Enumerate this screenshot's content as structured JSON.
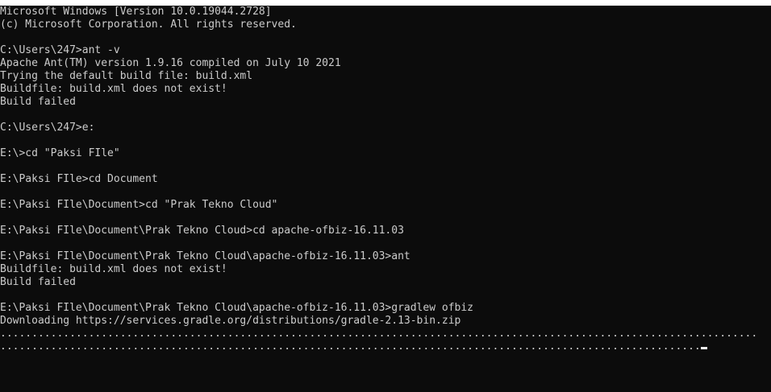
{
  "console": {
    "lines": [
      "Microsoft Windows [Version 10.0.19044.2728]",
      "(c) Microsoft Corporation. All rights reserved.",
      "",
      "C:\\Users\\247>ant -v",
      "Apache Ant(TM) version 1.9.16 compiled on July 10 2021",
      "Trying the default build file: build.xml",
      "Buildfile: build.xml does not exist!",
      "Build failed",
      "",
      "C:\\Users\\247>e:",
      "",
      "E:\\>cd \"Paksi FIle\"",
      "",
      "E:\\Paksi FIle>cd Document",
      "",
      "E:\\Paksi FIle\\Document>cd \"Prak Tekno Cloud\"",
      "",
      "E:\\Paksi FIle\\Document\\Prak Tekno Cloud>cd apache-ofbiz-16.11.03",
      "",
      "E:\\Paksi FIle\\Document\\Prak Tekno Cloud\\apache-ofbiz-16.11.03>ant",
      "Buildfile: build.xml does not exist!",
      "Build failed",
      "",
      "E:\\Paksi FIle\\Document\\Prak Tekno Cloud\\apache-ofbiz-16.11.03>gradlew ofbiz",
      "Downloading https://services.gradle.org/distributions/gradle-2.13-bin.zip",
      "........................................................................................................................",
      "..............................................................................................................."
    ]
  }
}
